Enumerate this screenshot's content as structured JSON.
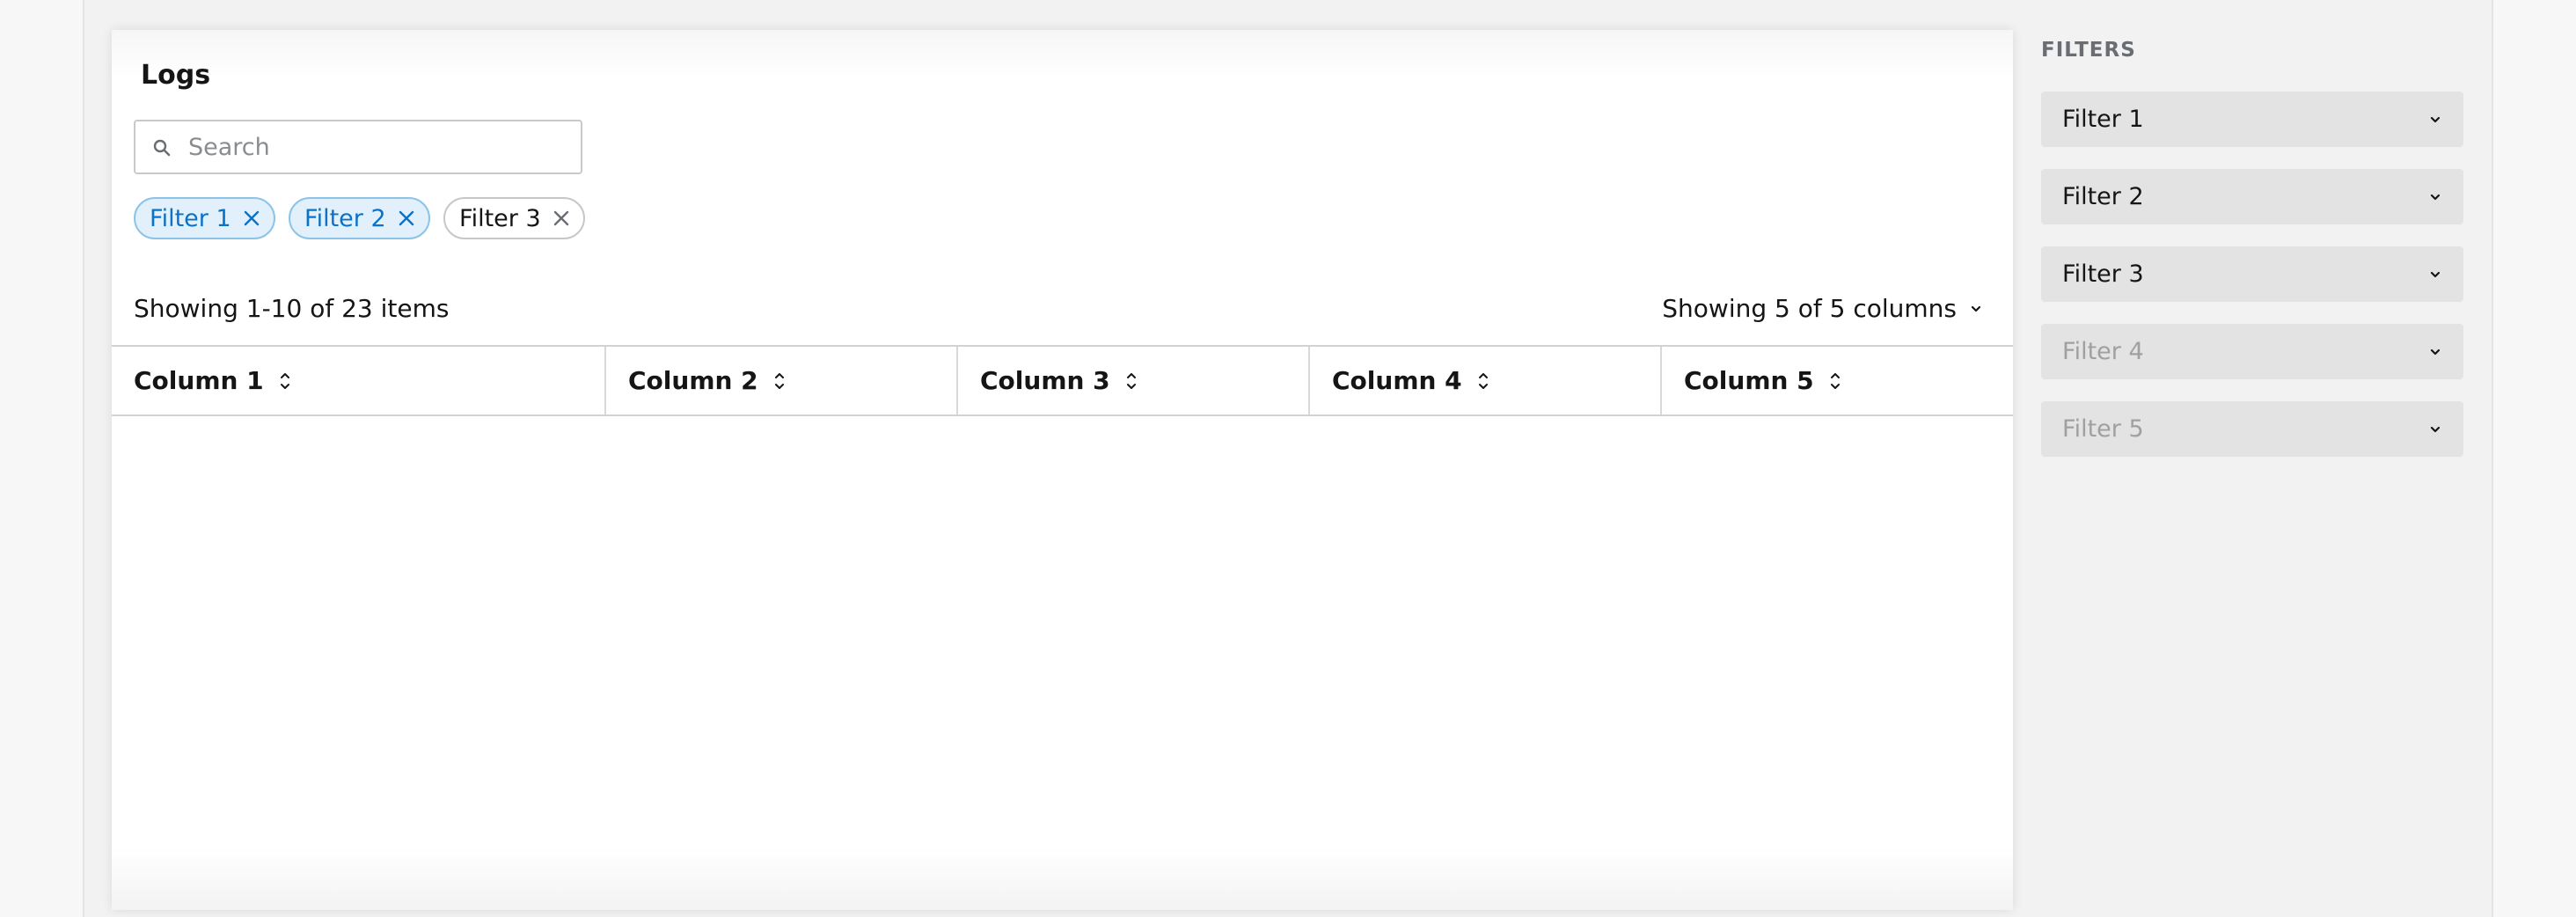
{
  "main": {
    "title": "Logs",
    "search": {
      "placeholder": "Search",
      "value": ""
    },
    "chips": [
      {
        "label": "Filter 1",
        "active": true
      },
      {
        "label": "Filter 2",
        "active": true
      },
      {
        "label": "Filter 3",
        "active": false
      }
    ],
    "summary": "Showing 1-10 of 23 items",
    "columns_toggle": "Showing 5 of 5 columns",
    "table": {
      "columns": [
        "Column 1",
        "Column 2",
        "Column 3",
        "Column 4",
        "Column 5"
      ],
      "rows": []
    }
  },
  "sidebar": {
    "title": "FILTERS",
    "filters": [
      {
        "label": "Filter 1",
        "enabled": true
      },
      {
        "label": "Filter 2",
        "enabled": true
      },
      {
        "label": "Filter 3",
        "enabled": true
      },
      {
        "label": "Filter 4",
        "enabled": false
      },
      {
        "label": "Filter 5",
        "enabled": false
      }
    ]
  },
  "icons": {
    "search": "search-icon",
    "chip_remove": "close-icon",
    "column_sort": "sort-icon",
    "dropdown": "chevron-down-icon"
  },
  "colors": {
    "chip_active_bg": "#e1f0fb",
    "chip_active_border": "#8cc3e8",
    "chip_active_text": "#0a72c7",
    "filter_select_bg": "#e3e3e3",
    "filter_disabled_text": "#a0a0a0"
  }
}
